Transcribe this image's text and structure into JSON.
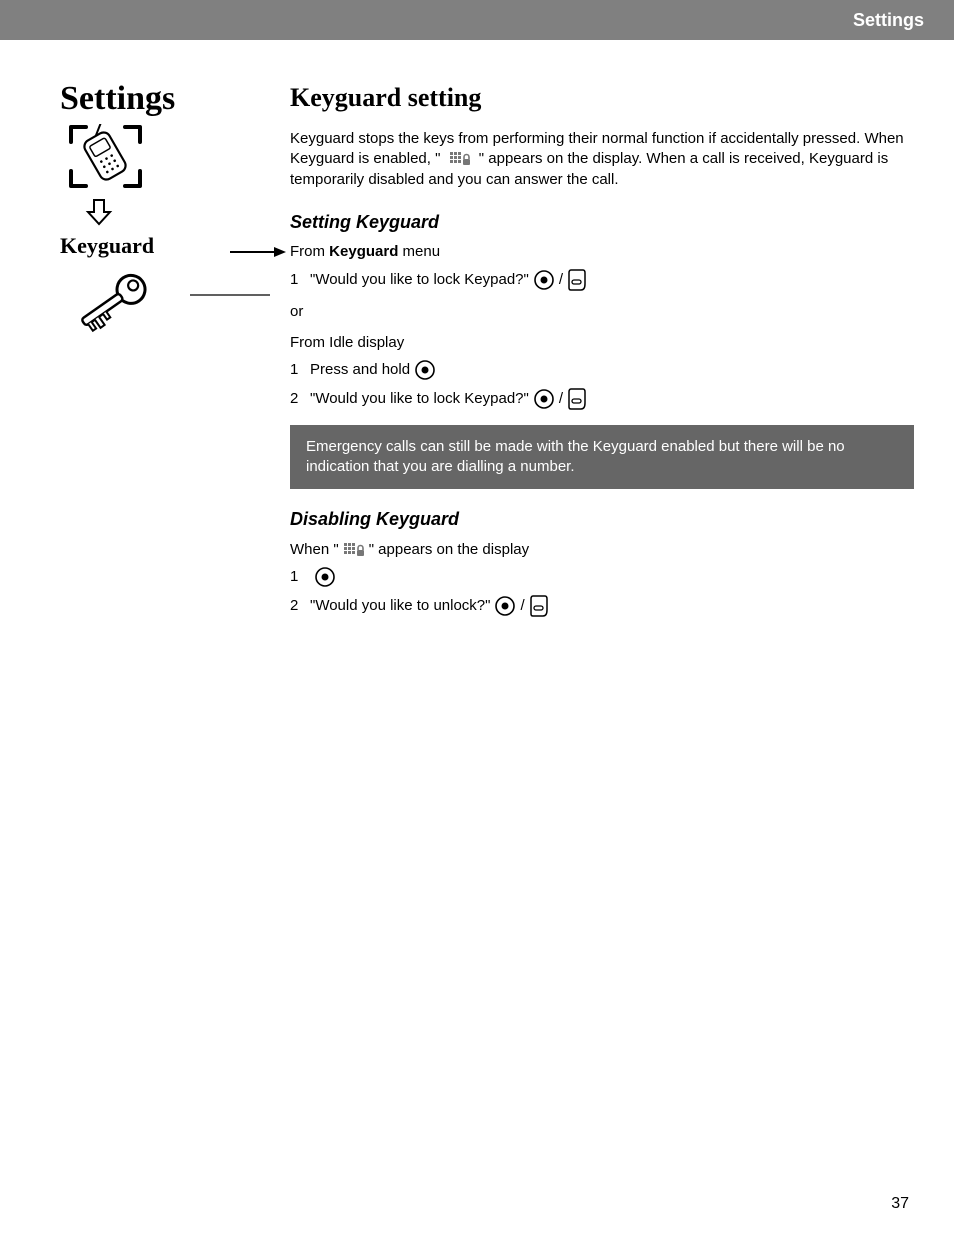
{
  "header": "Settings",
  "sidebar": {
    "title": "Settings",
    "label": "Keyguard"
  },
  "main": {
    "heading": "Keyguard setting",
    "intro_before": "Keyguard stops the keys from performing their normal function if accidentally pressed. When Keyguard is enabled, \" ",
    "intro_after": " \" appears on the display. When a call is received, Keyguard is temporarily disabled and you can answer the call.",
    "setting_heading": "Setting Keyguard",
    "from_prefix": "From ",
    "from_bold": "Keyguard",
    "from_suffix": " menu",
    "step1_num": "1",
    "step1_text": "\"Would you like to lock Keypad?\" ",
    "or": "or",
    "from_idle": "From Idle display",
    "idle_step1_num": "1",
    "idle_step1_text": "Press and hold ",
    "idle_step2_num": "2",
    "idle_step2_text": "\"Would you like to lock Keypad?\" ",
    "note": "Emergency calls can still be made with the Keyguard enabled but there will be no indication that you are dialling a number.",
    "disabling_heading": "Disabling Keyguard",
    "when_before": "When \" ",
    "when_after": " \" appears on the display",
    "dis_step1_num": "1",
    "dis_step2_num": "2",
    "dis_step2_text": "\"Would you like to unlock?\" "
  },
  "page_number": "37"
}
